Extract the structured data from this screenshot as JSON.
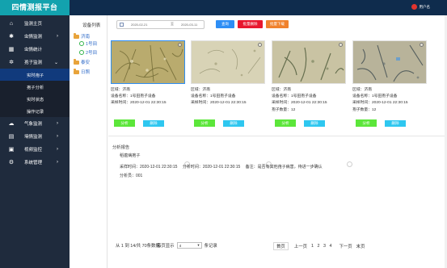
{
  "app": {
    "title": "四情测报平台",
    "user_label": "用户名"
  },
  "sidebar": {
    "items": [
      {
        "label": "监测主页",
        "icon": "home-icon"
      },
      {
        "label": "虫情监测",
        "icon": "bug-icon",
        "expandable": true
      },
      {
        "label": "虫情统计",
        "icon": "chart-icon"
      },
      {
        "label": "孢子监测",
        "icon": "gear-icon",
        "expandable": true,
        "open": true
      },
      {
        "label": "气象监测",
        "icon": "cloud-icon",
        "expandable": true
      },
      {
        "label": "墒情监测",
        "icon": "soil-icon",
        "expandable": true
      },
      {
        "label": "视频监控",
        "icon": "video-icon",
        "expandable": true
      },
      {
        "label": "系统管理",
        "icon": "settings-icon",
        "expandable": true
      }
    ],
    "sub_items": [
      {
        "label": "实时孢子",
        "active": true
      },
      {
        "label": "孢子分析"
      },
      {
        "label": "实时状态"
      },
      {
        "label": "操作记录"
      }
    ]
  },
  "tree": {
    "title": "设备列表",
    "nodes": [
      {
        "label": "济南",
        "type": "folder"
      },
      {
        "label": "1号田",
        "type": "leaf"
      },
      {
        "label": "2号田",
        "type": "leaf"
      },
      {
        "label": "泰安",
        "type": "folder"
      },
      {
        "label": "日照",
        "type": "folder"
      }
    ]
  },
  "toolbar": {
    "date_start": "2020-02-21",
    "date_sep": "至",
    "date_end": "2020-03-11",
    "query_label": "查询",
    "batch_delete_label": "批量删除",
    "batch_download_label": "批量下载"
  },
  "cards": [
    {
      "region": "区域：济南",
      "device": "设备名称：1号田孢子设备",
      "time": "采样时间：2020-12-01 22:30:15",
      "count": "",
      "analyze_label": "分析",
      "delete_label": "删除"
    },
    {
      "region": "区域：济南",
      "device": "设备名称：1号田孢子设备",
      "time": "采样时间：2020-12-01 22:30:15",
      "count": "",
      "analyze_label": "分析",
      "delete_label": "删除"
    },
    {
      "region": "区域：济南",
      "device": "设备名称：1号田孢子设备",
      "time": "采样时间：2020-12-01 22:30:15",
      "count": "孢子数量：12",
      "analyze_label": "分析",
      "delete_label": "删除"
    },
    {
      "region": "区域：济南",
      "device": "设备名称：1号田孢子设备",
      "time": "采样时间：2020-12-01 22:30:15",
      "count": "孢子数量：12",
      "analyze_label": "分析",
      "delete_label": "删除"
    }
  ],
  "report": {
    "title": "分析报告",
    "subtitle": "稻瘟病孢子",
    "device": "采样时间：2020-12-01 22:30:15",
    "analysis_time": "分析时间：2020-12-01 22:30:15",
    "note": "备注：是否有其他孢子病害，待进一步确认",
    "analyst": "分析员：001"
  },
  "pager": {
    "info": "从 1 到 14/共 70条数据",
    "per_page_prefix": "每页显示",
    "per_page_value": "4",
    "per_page_suffix": "条记录",
    "first": "首页",
    "prev": "上一页",
    "pages": [
      "1",
      "2",
      "3",
      "4"
    ],
    "next": "下一页",
    "last": "末页"
  },
  "colors": {
    "topbar": "#0f2c4d",
    "logo": "#13a2ae",
    "sidebar": "#1f2b3d",
    "sub_active": "#113a7c",
    "query": "#2e8ef5",
    "delete": "#e8172e",
    "download": "#f0822d",
    "analyze": "#5ce63a",
    "remove": "#2ec7f0"
  }
}
